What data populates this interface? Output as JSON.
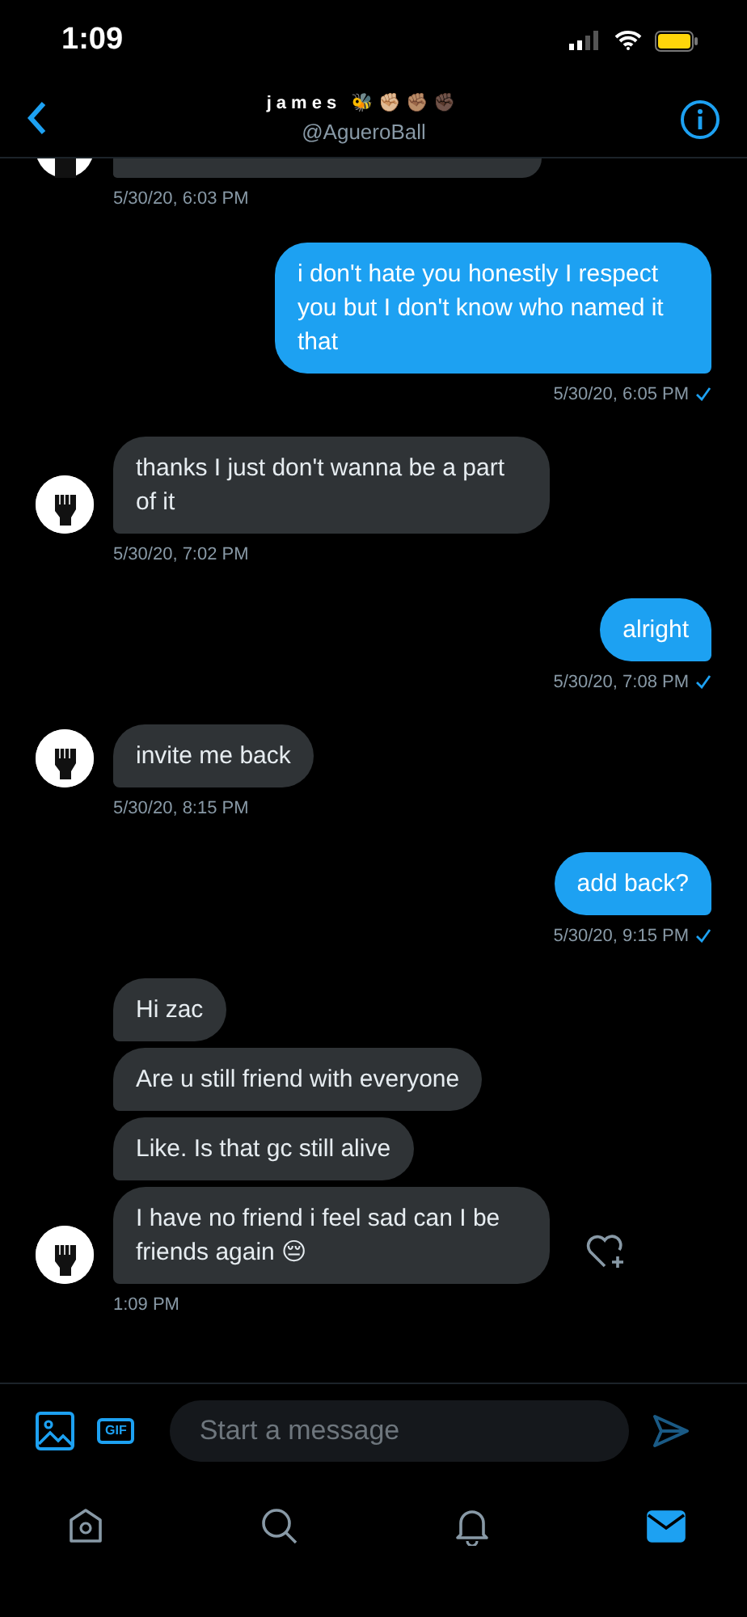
{
  "status_bar": {
    "time": "1:09"
  },
  "header": {
    "name": "james 🐝✊🏼✊🏽✊🏿",
    "handle": "@AgueroBall"
  },
  "messages": [
    {
      "kind": "partial",
      "avatar": true,
      "time": "5/30/20, 6:03 PM"
    },
    {
      "kind": "sent",
      "text": "i don't hate you honestly I respect you but I don't know who named it that",
      "time": "5/30/20, 6:05 PM",
      "read": true
    },
    {
      "kind": "received",
      "avatar": true,
      "text": "thanks I just don't wanna be a part of it",
      "time": "5/30/20, 7:02 PM"
    },
    {
      "kind": "sent",
      "text": "alright",
      "time": "5/30/20, 7:08 PM",
      "read": true
    },
    {
      "kind": "received",
      "avatar": true,
      "text": "invite me back",
      "time": "5/30/20, 8:15 PM"
    },
    {
      "kind": "sent",
      "text": "add back?",
      "time": "5/30/20, 9:15 PM",
      "read": true
    },
    {
      "kind": "received",
      "avatar": false,
      "text": "Hi zac"
    },
    {
      "kind": "received",
      "avatar": false,
      "text": "Are u still friend with everyone"
    },
    {
      "kind": "received",
      "avatar": false,
      "text": "Like. Is that gc still alive"
    },
    {
      "kind": "received",
      "avatar": true,
      "text": "I have no friend i feel sad can I be friends again 😔",
      "time": "1:09 PM",
      "like_button": true
    }
  ],
  "composer": {
    "placeholder": "Start a message",
    "gif_label": "GIF"
  },
  "tabs": [
    {
      "kind": "home",
      "selected": false
    },
    {
      "kind": "search",
      "selected": false
    },
    {
      "kind": "notifications",
      "selected": false
    },
    {
      "kind": "messages",
      "selected": true
    }
  ]
}
